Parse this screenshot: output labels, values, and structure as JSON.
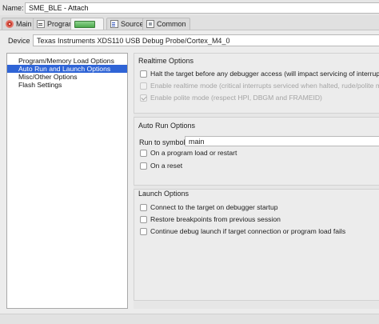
{
  "header": {
    "name_label": "Name:",
    "name_value": "SME_BLE - Attach"
  },
  "tabs": [
    {
      "label": "Main",
      "icon": "main-icon"
    },
    {
      "label": "Program",
      "icon": "program-icon"
    },
    {
      "label": "",
      "icon": "target-icon"
    },
    {
      "label": "Source",
      "icon": "source-icon"
    },
    {
      "label": "Common",
      "icon": "common-icon"
    }
  ],
  "device": {
    "label": "Device",
    "value": "Texas Instruments XDS110 USB Debug Probe/Cortex_M4_0"
  },
  "tree": {
    "items": [
      {
        "label": "Program/Memory Load Options",
        "selected": false
      },
      {
        "label": "Auto Run and Launch Options",
        "selected": true
      },
      {
        "label": "Misc/Other Options",
        "selected": false
      },
      {
        "label": "Flash Settings",
        "selected": false
      }
    ]
  },
  "realtime": {
    "title": "Realtime Options",
    "options": [
      {
        "label": "Halt the target before any debugger access (will impact servicing of interrupts)",
        "checked": false,
        "enabled": true
      },
      {
        "label": "Enable realtime mode (critical interrupts serviced when halted, rude/polite mode)",
        "checked": false,
        "enabled": false
      },
      {
        "label": "Enable polite mode (respect HPI, DBGM and FRAMEID)",
        "checked": true,
        "enabled": false
      }
    ]
  },
  "autorun": {
    "title": "Auto Run Options",
    "run_to_label": "Run to symbol",
    "run_to_value": "main",
    "options": [
      {
        "label": "On a program load or restart",
        "checked": false,
        "enabled": true
      },
      {
        "label": "On a reset",
        "checked": false,
        "enabled": true
      }
    ]
  },
  "launch": {
    "title": "Launch Options",
    "options": [
      {
        "label": "Connect to the target on debugger startup",
        "checked": false,
        "enabled": true
      },
      {
        "label": "Restore breakpoints from previous session",
        "checked": false,
        "enabled": true
      },
      {
        "label": "Continue debug launch if target connection or program load fails",
        "checked": false,
        "enabled": true
      }
    ]
  },
  "colors": {
    "selection": "#2f64d6",
    "disabled_text": "#a4a4a4"
  }
}
